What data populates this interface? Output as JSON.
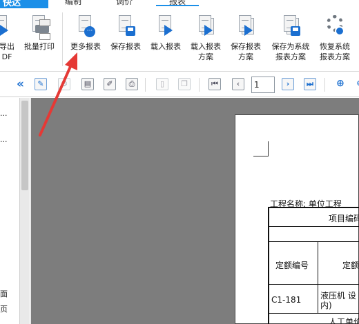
{
  "app": {
    "brand": "快达",
    "menu_tabs": [
      "编制",
      "调价",
      "报表"
    ],
    "active_tab": "报表"
  },
  "ribbon": {
    "buttons": [
      {
        "label_line1": "导出",
        "label_line2": "DF",
        "icon": "export-pdf-icon"
      },
      {
        "label_line1": "批量打印",
        "label_line2": "",
        "icon": "printer-icon"
      },
      {
        "label_line1": "更多报表",
        "label_line2": "",
        "icon": "more-reports-icon"
      },
      {
        "label_line1": "保存报表",
        "label_line2": "",
        "icon": "save-report-icon"
      },
      {
        "label_line1": "载入报表",
        "label_line2": "",
        "icon": "load-report-icon"
      },
      {
        "label_line1": "载入报表",
        "label_line2": "方案",
        "icon": "load-report-scheme-icon"
      },
      {
        "label_line1": "保存报表",
        "label_line2": "方案",
        "icon": "save-report-scheme-icon"
      },
      {
        "label_line1": "保存为系统",
        "label_line2": "报表方案",
        "icon": "save-system-scheme-icon"
      },
      {
        "label_line1": "恢复系统",
        "label_line2": "报表方案",
        "icon": "restore-system-scheme-icon"
      }
    ]
  },
  "toolbar": {
    "collapse_glyph": "«",
    "page_number": "1"
  },
  "left_panel": {
    "dots": [
      "...",
      "..."
    ],
    "bottom_lines": [
      "面",
      "页"
    ]
  },
  "report": {
    "project_label": "工程名称: 单位工程",
    "header_cell": "项目编码",
    "col1_header": "定额编号",
    "col2_header": "定额",
    "row1_code": "C1-181",
    "row1_desc_line1": "液压机 设",
    "row1_desc_line2": "内)",
    "footer_cell": "人工单价"
  },
  "colors": {
    "brand_blue": "#1b8fe8",
    "arrow_red": "#e53935",
    "preview_bg": "#7d7d7d"
  }
}
